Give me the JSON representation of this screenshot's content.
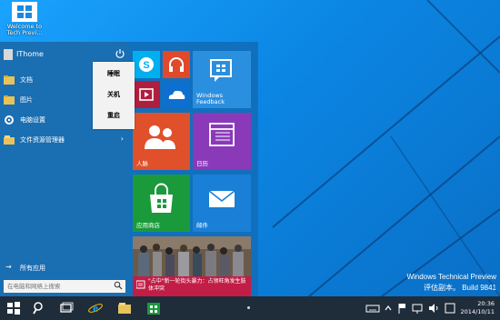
{
  "desktop": {
    "icon_label": "Welcome to Tech Previ...",
    "watermark_line1": "Windows Technical Preview",
    "watermark_line2": "评估副本。 Build 9841"
  },
  "start_menu": {
    "user_name": "IThome",
    "items": [
      {
        "label": "文档",
        "icon": "folder-icon"
      },
      {
        "label": "图片",
        "icon": "folder-icon"
      },
      {
        "label": "电脑设置",
        "icon": "gear-icon"
      },
      {
        "label": "文件资源管理器",
        "icon": "file-explorer-icon"
      }
    ],
    "all_apps_label": "所有应用",
    "search_placeholder": "在电脑和网络上搜索"
  },
  "power_menu": {
    "items": [
      "睡眠",
      "关机",
      "重启"
    ]
  },
  "tiles": {
    "windows_feedback": "Windows Feedback",
    "people": "人脉",
    "calendar": "日历",
    "store": "应用商店",
    "mail": "邮件",
    "news": "\"占中\"新一轮街头暴力：占领旺角发生肢体冲突",
    "colors": {
      "skype": "#00aff0",
      "music": "#e04a2b",
      "video": "#b01e3e",
      "onedrive": "#0d6fd0",
      "feedback": "#2b8fe0",
      "people": "#e0502a",
      "calendar": "#8a3ab9",
      "store": "#1a9a3a",
      "mail": "#1a7fd6",
      "news": "#c21d46"
    }
  },
  "taskbar": {
    "time": "20:36",
    "date": "2014/10/11"
  }
}
